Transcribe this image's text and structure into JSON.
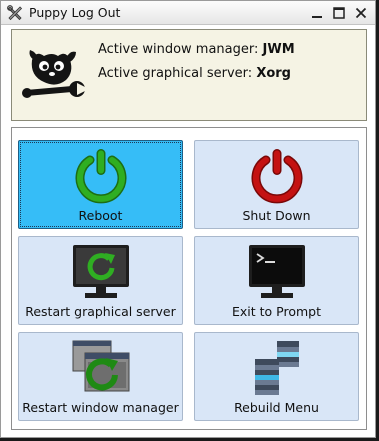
{
  "window": {
    "title": "Puppy Log Out",
    "app_icon": "tools-icon",
    "controls": [
      "minimize-icon",
      "maximize-icon",
      "close-icon"
    ]
  },
  "info": {
    "icon": "puppy-mascot-icon",
    "wm_label": "Active window manager: ",
    "wm_value": "JWM",
    "server_label": "Active graphical server: ",
    "server_value": "Xorg"
  },
  "actions": [
    {
      "label": "Reboot",
      "icon": "power-green-icon",
      "selected": true
    },
    {
      "label": "Shut Down",
      "icon": "power-red-icon",
      "selected": false
    },
    {
      "label": "Restart graphical server",
      "icon": "monitor-restart-icon",
      "selected": false
    },
    {
      "label": "Exit to Prompt",
      "icon": "terminal-monitor-icon",
      "selected": false
    },
    {
      "label": "Restart window manager",
      "icon": "windows-restart-icon",
      "selected": false
    },
    {
      "label": "Rebuild Menu",
      "icon": "menu-stack-icon",
      "selected": false
    }
  ],
  "colors": {
    "selected_tile": "#36bdf7",
    "tile": "#d9e6f7",
    "info_background": "#f5f3e4",
    "power_green": "#2a9a1e",
    "power_red": "#b80f0f"
  }
}
